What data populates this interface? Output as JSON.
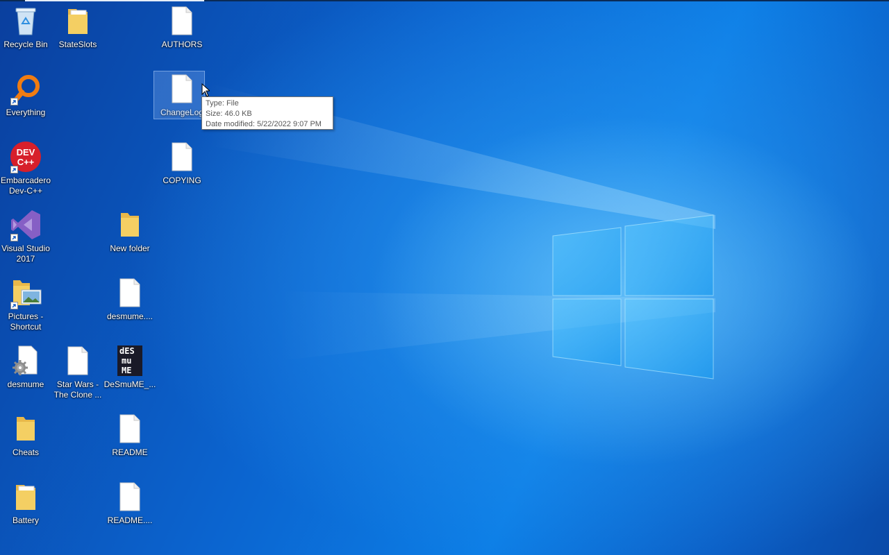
{
  "colors": {
    "wallpaper_primary": "#0b64cf",
    "wallpaper_glow": "#8cdcff",
    "tooltip_bg": "#ffffff",
    "tooltip_text": "#575757",
    "folder_yellow": "#f4cf63",
    "file_white": "#ffffff"
  },
  "desktop": {
    "icons": [
      {
        "label": "Recycle Bin",
        "icon": "recycle-bin-icon"
      },
      {
        "label": "StateSlots",
        "icon": "folder-icon"
      },
      {
        "label": "AUTHORS",
        "icon": "file-icon"
      },
      {
        "label": "Everything",
        "icon": "everything-search-icon",
        "shortcut": true
      },
      {
        "label": "ChangeLog",
        "icon": "file-icon",
        "selected": true
      },
      {
        "label": "Embarcadero Dev-C++",
        "icon": "devcpp-icon",
        "shortcut": true
      },
      {
        "label": "COPYING",
        "icon": "file-icon"
      },
      {
        "label": "Visual Studio 2017",
        "icon": "visual-studio-icon",
        "shortcut": true
      },
      {
        "label": "New folder",
        "icon": "folder-icon"
      },
      {
        "label": "Pictures - Shortcut",
        "icon": "pictures-folder-icon",
        "shortcut": true
      },
      {
        "label": "desmume....",
        "icon": "file-icon"
      },
      {
        "label": "desmume",
        "icon": "settings-file-icon"
      },
      {
        "label": "Star Wars - The Clone ...",
        "icon": "file-icon"
      },
      {
        "label": "DeSmuME_...",
        "icon": "desmume-app-icon"
      },
      {
        "label": "Cheats",
        "icon": "folder-icon"
      },
      {
        "label": "README",
        "icon": "file-icon"
      },
      {
        "label": "Battery",
        "icon": "folder-icon"
      },
      {
        "label": "README....",
        "icon": "file-icon"
      }
    ]
  },
  "tooltip": {
    "type_line": "Type: File",
    "size_line": "Size: 46.0 KB",
    "date_line": "Date modified: 5/22/2022 9:07 PM"
  }
}
